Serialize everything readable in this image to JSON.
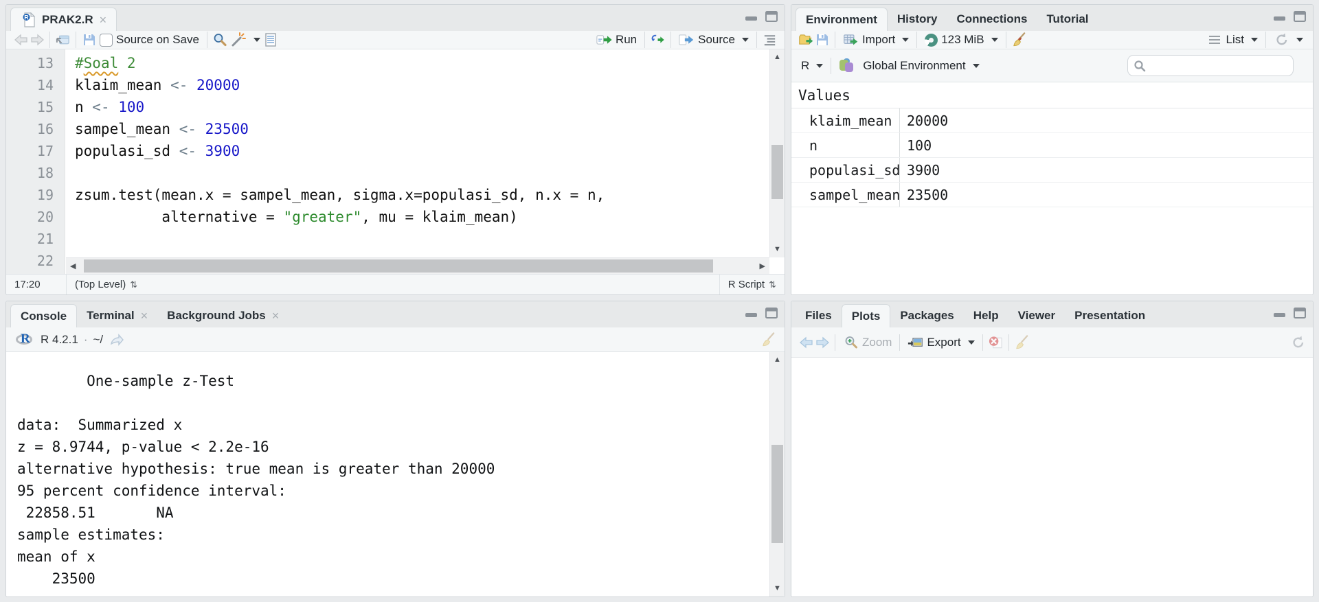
{
  "colors": {
    "syntax_comment": "#3d8b37",
    "syntax_number": "#1616c8",
    "syntax_operator": "#6a7b88",
    "syntax_string": "#2e8b2e",
    "run_green": "#2f9e44",
    "source_blue": "#5b9bd5",
    "rerun_blue": "#3e6fd1",
    "r_logo_blue": "#2064b5"
  },
  "editor": {
    "tab": {
      "title": "PRAK2.R"
    },
    "toolbar": {
      "source_on_save": "Source on Save",
      "run": "Run",
      "source": "Source"
    },
    "code": {
      "lines": [
        {
          "n": 13,
          "segs": [
            {
              "t": "#",
              "y": "c"
            },
            {
              "t": "Soal",
              "y": "c",
              "w": true
            },
            {
              "t": " 2",
              "y": "c"
            }
          ]
        },
        {
          "n": 14,
          "segs": [
            {
              "t": "klaim_mean ",
              "y": "p"
            },
            {
              "t": "<- ",
              "y": "o"
            },
            {
              "t": "20000",
              "y": "n"
            }
          ]
        },
        {
          "n": 15,
          "segs": [
            {
              "t": "n ",
              "y": "p"
            },
            {
              "t": "<- ",
              "y": "o"
            },
            {
              "t": "100",
              "y": "n"
            }
          ]
        },
        {
          "n": 16,
          "segs": [
            {
              "t": "sampel_mean ",
              "y": "p"
            },
            {
              "t": "<- ",
              "y": "o"
            },
            {
              "t": "23500",
              "y": "n"
            }
          ]
        },
        {
          "n": 17,
          "segs": [
            {
              "t": "populasi_sd ",
              "y": "p"
            },
            {
              "t": "<- ",
              "y": "o"
            },
            {
              "t": "3900",
              "y": "n"
            }
          ]
        },
        {
          "n": 18,
          "segs": []
        },
        {
          "n": 19,
          "segs": [
            {
              "t": "zsum.test(mean.x = sampel_mean, sigma.x=populasi_sd, n.x = n,",
              "y": "p"
            }
          ]
        },
        {
          "n": 20,
          "segs": [
            {
              "t": "          alternative = ",
              "y": "p"
            },
            {
              "t": "\"greater\"",
              "y": "s"
            },
            {
              "t": ", mu = klaim_mean)",
              "y": "p"
            }
          ]
        },
        {
          "n": 21,
          "segs": []
        },
        {
          "n": 22,
          "segs": []
        }
      ]
    },
    "status": {
      "cursor": "17:20",
      "scope": "(Top Level)",
      "filetype": "R Script"
    }
  },
  "console": {
    "tabs": [
      "Console",
      "Terminal",
      "Background Jobs"
    ],
    "r_version": "R 4.2.1",
    "separator": "·",
    "path": "~/",
    "output_lines": [
      "        One-sample z-Test",
      "",
      "data:  Summarized x",
      "z = 8.9744, p-value < 2.2e-16",
      "alternative hypothesis: true mean is greater than 20000",
      "95 percent confidence interval:",
      " 22858.51       NA",
      "sample estimates:",
      "mean of x",
      "    23500"
    ]
  },
  "environment": {
    "tabs": [
      "Environment",
      "History",
      "Connections",
      "Tutorial"
    ],
    "toolbar": {
      "import": "Import",
      "memory": "123 MiB",
      "list": "List"
    },
    "lang": "R",
    "scope": "Global Environment",
    "section": "Values",
    "variables": [
      {
        "name": "klaim_mean",
        "value": "20000"
      },
      {
        "name": "n",
        "value": "100"
      },
      {
        "name": "populasi_sd",
        "value": "3900"
      },
      {
        "name": "sampel_mean",
        "value": "23500"
      }
    ]
  },
  "plots": {
    "tabs": [
      "Files",
      "Plots",
      "Packages",
      "Help",
      "Viewer",
      "Presentation"
    ],
    "toolbar": {
      "zoom": "Zoom",
      "export": "Export"
    }
  }
}
